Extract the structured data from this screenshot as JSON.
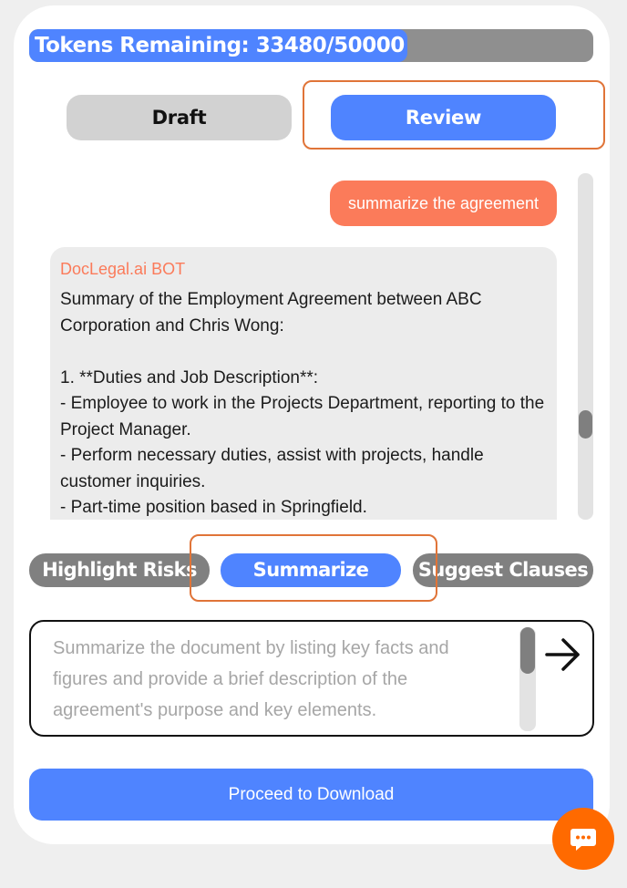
{
  "tokens": {
    "text": "Tokens Remaining: 33480/50000",
    "remaining": 33480,
    "total": 50000,
    "fill_fraction": 0.67
  },
  "tabs": [
    {
      "label": "Draft",
      "active": false
    },
    {
      "label": "Review",
      "active": true
    }
  ],
  "chat": {
    "user_message": "summarize the agreement",
    "bot_name": "DocLegal.ai BOT",
    "bot_message": "Summary of the Employment Agreement between ABC Corporation and Chris Wong:\n\n1. **Duties and Job Description**:\n- Employee to work in the Projects Department, reporting to the Project Manager.\n- Perform necessary duties, assist with projects, handle customer inquiries.\n- Part-time position based in Springfield."
  },
  "actions": [
    {
      "label": "Highlight Risks",
      "active": false
    },
    {
      "label": "Summarize",
      "active": true
    },
    {
      "label": "Suggest Clauses",
      "active": false
    }
  ],
  "prompt": {
    "placeholder": "Summarize the document by listing key facts and figures and provide a brief description of the agreement's purpose and key elements.",
    "send_icon": "arrow-right-icon"
  },
  "proceed_label": "Proceed to Download",
  "fab_icon": "chat-bubble-icon",
  "colors": {
    "accent": "#4f84ff",
    "bot_accent": "#fb7b5a",
    "fab": "#ff6a00",
    "highlight": "#e07438"
  }
}
